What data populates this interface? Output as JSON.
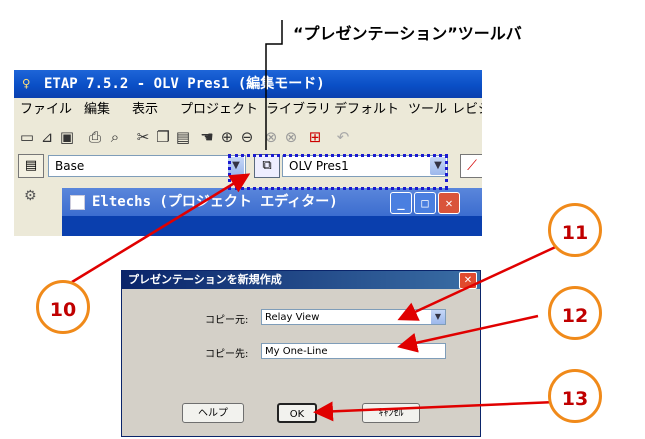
{
  "callout": {
    "title": "“プレゼンテーション”ツールバ"
  },
  "window": {
    "title": "ETAP 7.5.2 - OLV Pres1 (編集モード)",
    "menu": [
      "ファイル",
      "編集",
      "表示",
      "プロジェクト",
      "ライブラリ",
      "デフォルト",
      "ツール",
      "レビジ"
    ],
    "toolbar_icons": [
      "new-icon",
      "open-icon",
      "save-icon",
      "print-icon",
      "print-preview-icon",
      "cut-icon",
      "copy-icon",
      "paste-icon",
      "pan-icon",
      "zoom-in-icon",
      "zoom-out-icon",
      "zoom-extent-icon",
      "undo-icon"
    ],
    "base_combo_value": "Base",
    "presentation_combo_value": "OLV Pres1",
    "project_editor_title": "Eltechs (プロジェクト エディター)"
  },
  "dialog": {
    "title": "プレゼンテーションを新規作成",
    "copy_from_label": "コピー元:",
    "copy_from_value": "Relay View",
    "copy_to_label": "コピー先:",
    "copy_to_value": "My One-Line",
    "help_label": "ヘルプ",
    "ok_label": "OK",
    "cancel_label": "ｷｬﾝｾﾙ"
  },
  "markers": [
    "10",
    "11",
    "12",
    "13"
  ],
  "colors": {
    "marker_ring": "#f08a1a",
    "marker_text": "#c00000",
    "arrow": "#e00000",
    "highlight": "#1a1ad0"
  }
}
